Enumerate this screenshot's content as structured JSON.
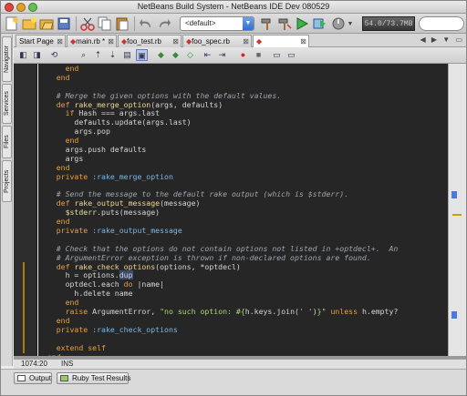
{
  "window": {
    "title": "NetBeans Build System - NetBeans IDE Dev 080529"
  },
  "toolbar": {
    "config": "<default>",
    "memory": "54.0/73.7MB"
  },
  "side_tabs": [
    "Navigator",
    "Services",
    "Files",
    "Projects"
  ],
  "tabs": [
    {
      "label": "Start Page",
      "active": false
    },
    {
      "label": "main.rb *",
      "active": false
    },
    {
      "label": "foo_test.rb",
      "active": false
    },
    {
      "label": "foo_spec.rb",
      "active": false
    },
    {
      "label": "",
      "active": true
    }
  ],
  "code_lines": [
    [
      [
        "      end",
        "kw"
      ]
    ],
    [
      [
        "    end",
        "kw"
      ]
    ],
    [
      [
        "",
        "pl"
      ]
    ],
    [
      [
        "    # Merge the given options with the default values.",
        "cm"
      ]
    ],
    [
      [
        "    def ",
        "kw"
      ],
      [
        "rake_merge_option",
        "fn"
      ],
      [
        "(args, defaults)",
        "pl"
      ]
    ],
    [
      [
        "      if ",
        "kw"
      ],
      [
        "Hash",
        "pl"
      ],
      [
        " === ",
        "pl"
      ],
      [
        "args.last",
        "pl"
      ]
    ],
    [
      [
        "        defaults.update(args.last)",
        "pl"
      ]
    ],
    [
      [
        "        args.pop",
        "pl"
      ]
    ],
    [
      [
        "      end",
        "kw"
      ]
    ],
    [
      [
        "      args.push defaults",
        "pl"
      ]
    ],
    [
      [
        "      args",
        "pl"
      ]
    ],
    [
      [
        "    end",
        "kw"
      ]
    ],
    [
      [
        "    private ",
        "kw"
      ],
      [
        ":rake_merge_option",
        "sy"
      ]
    ],
    [
      [
        "",
        "pl"
      ]
    ],
    [
      [
        "    # Send the message to the default rake output (which is $stderr).",
        "cm"
      ]
    ],
    [
      [
        "    def ",
        "kw"
      ],
      [
        "rake_output_message",
        "fn"
      ],
      [
        "(message)",
        "pl"
      ]
    ],
    [
      [
        "      $stderr",
        "gv"
      ],
      [
        ".puts(message)",
        "pl"
      ]
    ],
    [
      [
        "    end",
        "kw"
      ]
    ],
    [
      [
        "    private ",
        "kw"
      ],
      [
        ":rake_output_message",
        "sy"
      ]
    ],
    [
      [
        "",
        "pl"
      ]
    ],
    [
      [
        "    # Check that the options do not contain options not listed in +optdecl+.  An",
        "cm"
      ]
    ],
    [
      [
        "    # ArgumentError exception is thrown if non-declared options are found.",
        "cm"
      ]
    ],
    [
      [
        "    def ",
        "kw"
      ],
      [
        "rake_check_options",
        "fn"
      ],
      [
        "(options, *optdecl)",
        "pl"
      ]
    ],
    [
      [
        "      h = options.",
        "pl"
      ],
      [
        "dup",
        "hl"
      ]
    ],
    [
      [
        "      optdecl.each ",
        "pl"
      ],
      [
        "do",
        "kw"
      ],
      [
        " |name|",
        "pl"
      ]
    ],
    [
      [
        "        h.delete name",
        "pl"
      ]
    ],
    [
      [
        "      end",
        "kw"
      ]
    ],
    [
      [
        "      raise ",
        "kw"
      ],
      [
        "ArgumentError",
        "pl"
      ],
      [
        ", ",
        "pl"
      ],
      [
        "\"no such option: #{",
        "st"
      ],
      [
        "h.keys.join(",
        "pl"
      ],
      [
        "' '",
        "st"
      ],
      [
        ")",
        "pl"
      ],
      [
        "}\"",
        "st"
      ],
      [
        " unless ",
        "kw"
      ],
      [
        "h.empty?",
        "pl"
      ]
    ],
    [
      [
        "    end",
        "kw"
      ]
    ],
    [
      [
        "    private ",
        "kw"
      ],
      [
        ":rake_check_options",
        "sy"
      ]
    ],
    [
      [
        "",
        "pl"
      ]
    ],
    [
      [
        "    extend ",
        "kw"
      ],
      [
        "self",
        "kw"
      ]
    ],
    [
      [
        "  end",
        "kw"
      ]
    ]
  ],
  "code_colors": {
    "kw": "#e8a040",
    "fn": "#f0d890",
    "cm": "#9ea4b0",
    "st": "#a8d878",
    "sy": "#7fb6e0",
    "gv": "#e0e0a0",
    "pl": "#d6d6d6",
    "hl": "#d6d6d6"
  },
  "status": {
    "position": "1074:20",
    "mode": "INS"
  },
  "bottom_tabs": [
    "Output",
    "Ruby Test Results"
  ]
}
